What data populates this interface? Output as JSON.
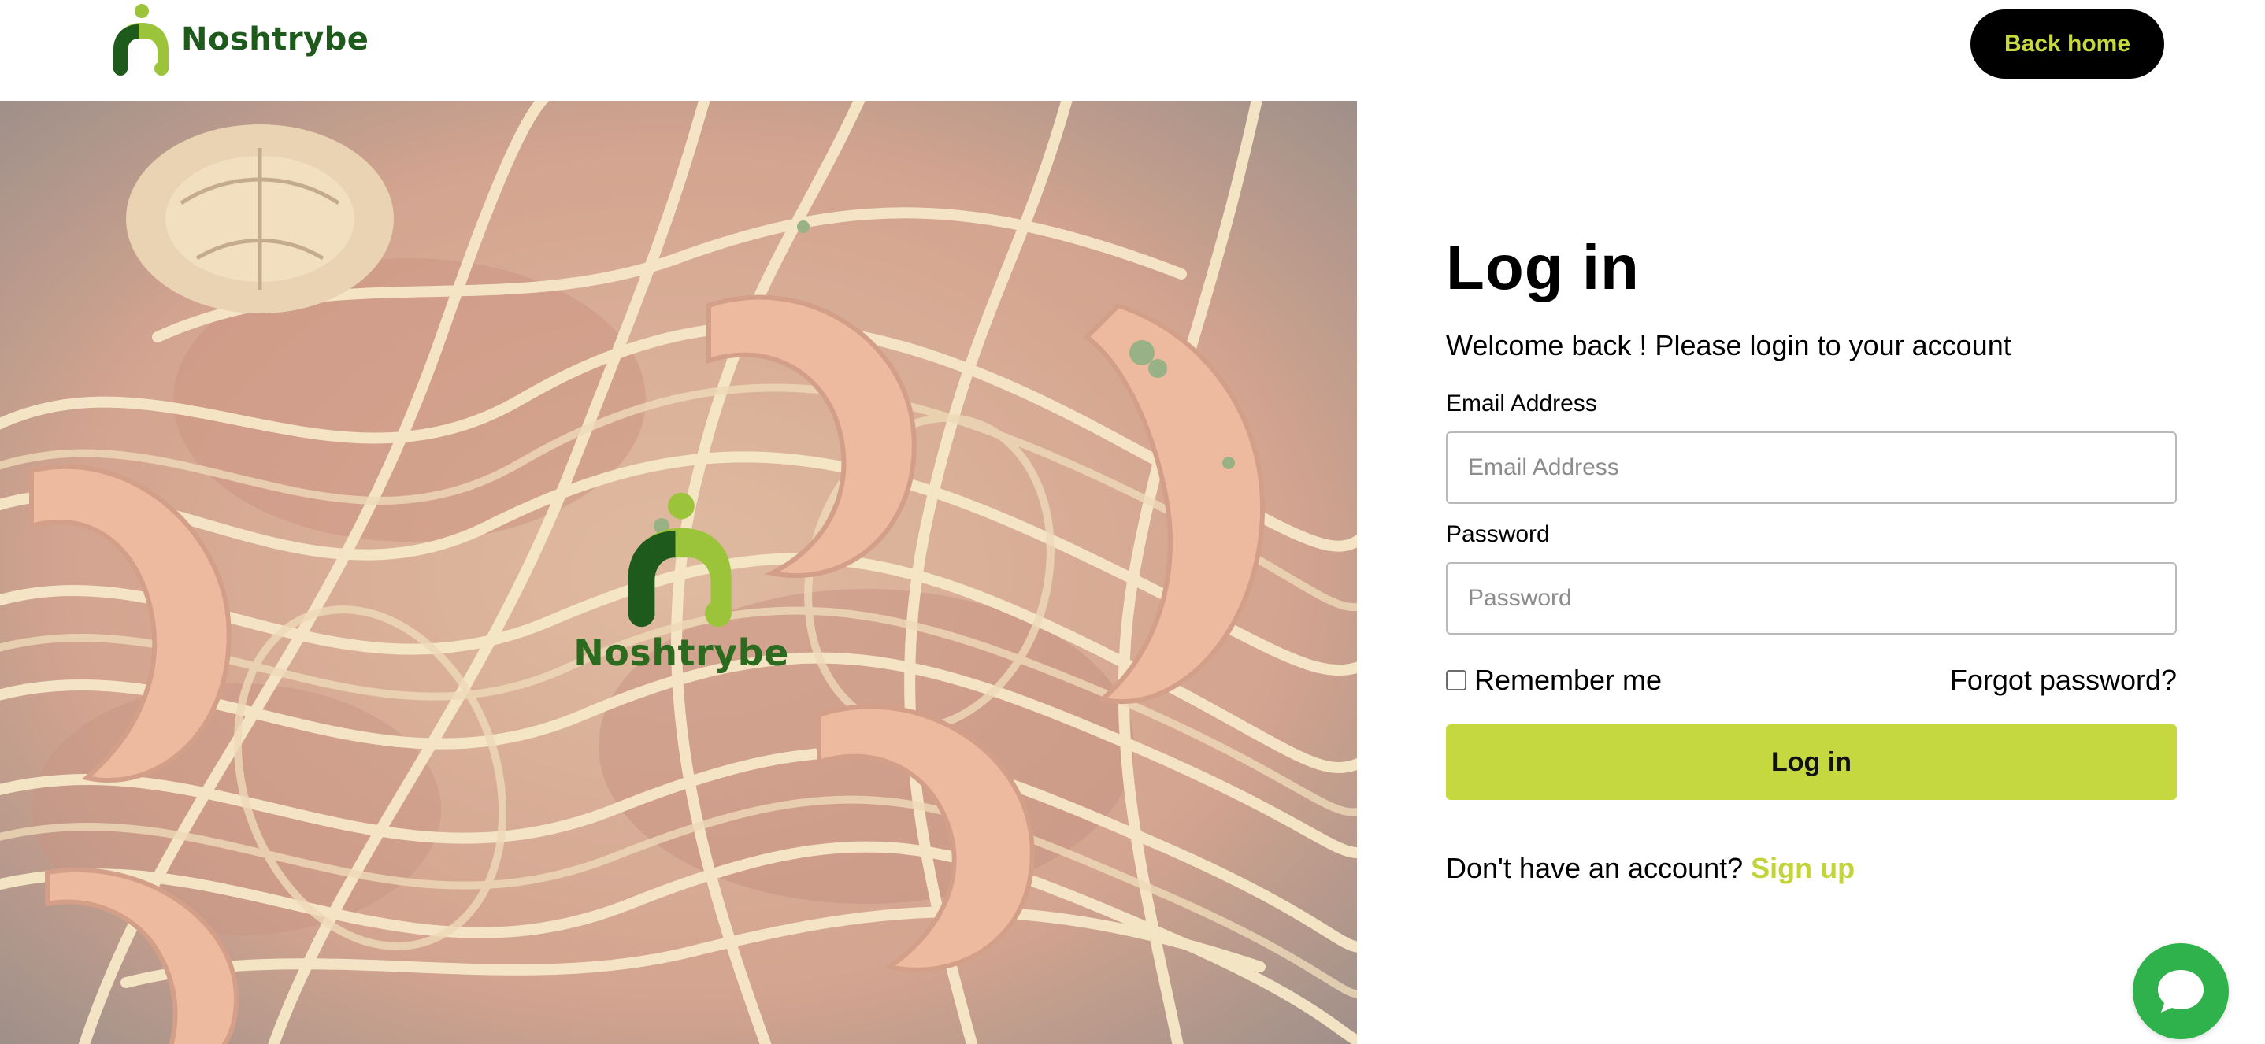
{
  "header": {
    "brand_name": "Noshtrybe",
    "back_home_label": "Back home"
  },
  "hero": {
    "brand_name": "Noshtrybe"
  },
  "login": {
    "title": "Log in",
    "subtitle": "Welcome back ! Please login to your account",
    "email": {
      "label": "Email Address",
      "placeholder": "Email Address",
      "value": ""
    },
    "password": {
      "label": "Password",
      "placeholder": "Password",
      "value": ""
    },
    "remember_label": "Remember me",
    "remember_checked": false,
    "forgot_label": "Forgot password?",
    "submit_label": "Log in",
    "signup_prompt": "Don't have an account?",
    "signup_link": "Sign up"
  },
  "chat": {
    "icon": "chat-bubble-icon"
  },
  "colors": {
    "brand_dark_green": "#1e5a1b",
    "brand_light_green": "#9cc43a",
    "accent_lime": "#c5d840",
    "button_black": "#000000",
    "chat_green": "#2fb24c"
  }
}
